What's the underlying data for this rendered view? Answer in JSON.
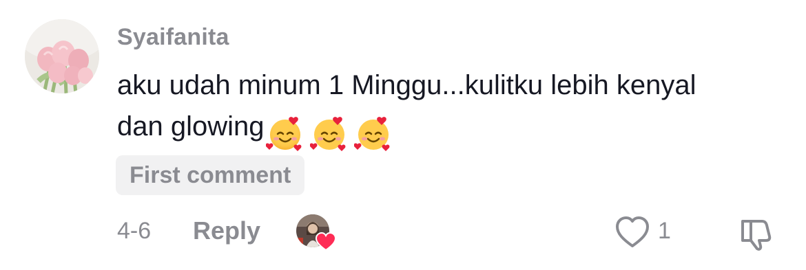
{
  "comment": {
    "username": "Syaifanita",
    "text": "aku udah minum 1 Minggu...kulitku lebih kenyal dan glowing",
    "emojis": [
      "smiling-face-with-hearts",
      "smiling-face-with-hearts",
      "smiling-face-with-hearts"
    ],
    "badge": "First comment",
    "date": "4-6",
    "reply_label": "Reply",
    "like_count": "1",
    "liked_by_creator": true
  },
  "colors": {
    "text": "#161823",
    "muted": "#8a8b91",
    "badge_bg": "#f1f1f2",
    "heart": "#fe2c55"
  },
  "icons": {
    "like": "heart-outline-icon",
    "dislike": "thumbs-down-outline-icon",
    "creator_like": "heart-filled-icon"
  }
}
